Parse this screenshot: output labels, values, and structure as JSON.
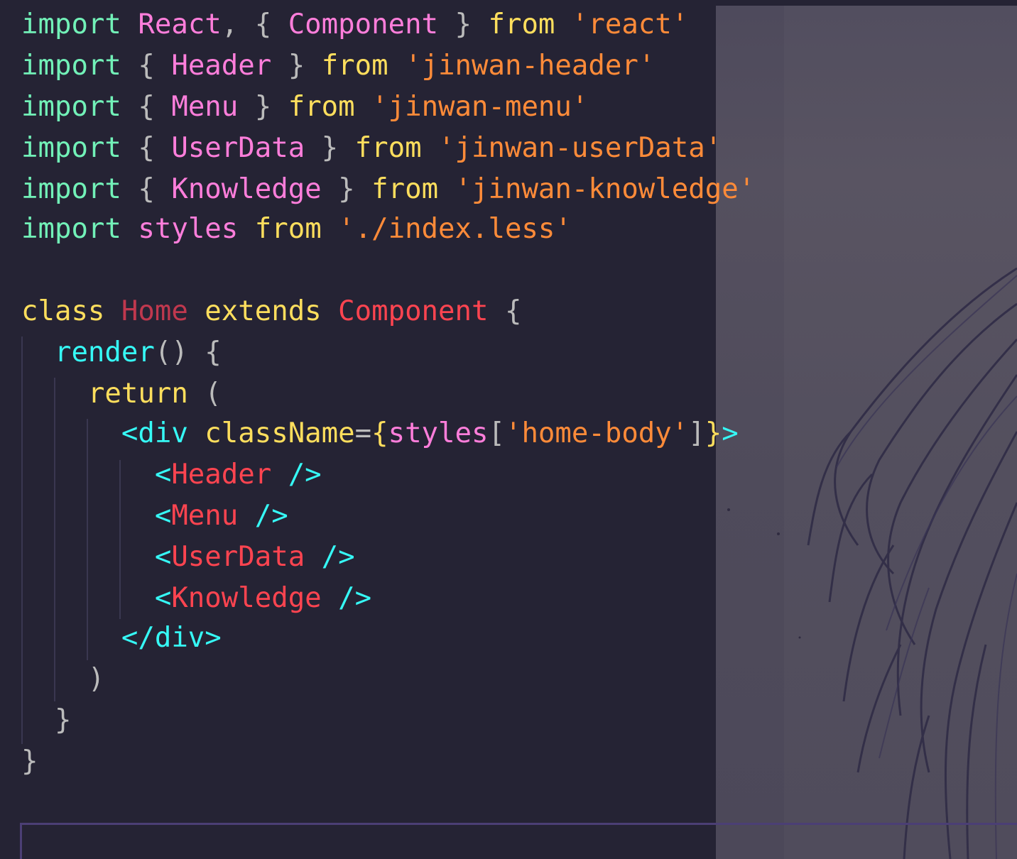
{
  "lines": [
    {
      "t": [
        {
          "c": "kw-green",
          "v": "import"
        },
        {
          "c": "plain",
          "v": " "
        },
        {
          "c": "pink",
          "v": "React"
        },
        {
          "c": "plain",
          "v": ", { "
        },
        {
          "c": "pink",
          "v": "Component"
        },
        {
          "c": "plain",
          "v": " } "
        },
        {
          "c": "kw-yellow",
          "v": "from"
        },
        {
          "c": "plain",
          "v": " "
        },
        {
          "c": "orange",
          "v": "'react'"
        }
      ]
    },
    {
      "t": [
        {
          "c": "kw-green",
          "v": "import"
        },
        {
          "c": "plain",
          "v": " { "
        },
        {
          "c": "pink",
          "v": "Header"
        },
        {
          "c": "plain",
          "v": " } "
        },
        {
          "c": "kw-yellow",
          "v": "from"
        },
        {
          "c": "plain",
          "v": " "
        },
        {
          "c": "orange",
          "v": "'jinwan-header'"
        }
      ]
    },
    {
      "t": [
        {
          "c": "kw-green",
          "v": "import"
        },
        {
          "c": "plain",
          "v": " { "
        },
        {
          "c": "pink",
          "v": "Menu"
        },
        {
          "c": "plain",
          "v": " } "
        },
        {
          "c": "kw-yellow",
          "v": "from"
        },
        {
          "c": "plain",
          "v": " "
        },
        {
          "c": "orange",
          "v": "'jinwan-menu'"
        }
      ]
    },
    {
      "t": [
        {
          "c": "kw-green",
          "v": "import"
        },
        {
          "c": "plain",
          "v": " { "
        },
        {
          "c": "pink",
          "v": "UserData"
        },
        {
          "c": "plain",
          "v": " } "
        },
        {
          "c": "kw-yellow",
          "v": "from"
        },
        {
          "c": "plain",
          "v": " "
        },
        {
          "c": "orange",
          "v": "'jinwan-userData'"
        }
      ]
    },
    {
      "t": [
        {
          "c": "kw-green",
          "v": "import"
        },
        {
          "c": "plain",
          "v": " { "
        },
        {
          "c": "pink",
          "v": "Knowledge"
        },
        {
          "c": "plain",
          "v": " } "
        },
        {
          "c": "kw-yellow",
          "v": "from"
        },
        {
          "c": "plain",
          "v": " "
        },
        {
          "c": "orange",
          "v": "'jinwan-knowledge'"
        }
      ]
    },
    {
      "t": [
        {
          "c": "kw-green",
          "v": "import"
        },
        {
          "c": "plain",
          "v": " "
        },
        {
          "c": "pink",
          "v": "styles"
        },
        {
          "c": "plain",
          "v": " "
        },
        {
          "c": "kw-yellow",
          "v": "from"
        },
        {
          "c": "plain",
          "v": " "
        },
        {
          "c": "orange",
          "v": "'./index.less'"
        }
      ]
    },
    {
      "t": []
    },
    {
      "t": [
        {
          "c": "kw-yellow",
          "v": "class"
        },
        {
          "c": "plain",
          "v": " "
        },
        {
          "c": "crimson",
          "v": "Home"
        },
        {
          "c": "plain",
          "v": " "
        },
        {
          "c": "kw-yellow",
          "v": "extends"
        },
        {
          "c": "plain",
          "v": " "
        },
        {
          "c": "red",
          "v": "Component"
        },
        {
          "c": "plain",
          "v": " {"
        }
      ]
    },
    {
      "t": [
        {
          "c": "plain",
          "v": "  "
        },
        {
          "c": "cyan",
          "v": "render"
        },
        {
          "c": "plain",
          "v": "() {"
        }
      ]
    },
    {
      "t": [
        {
          "c": "plain",
          "v": "    "
        },
        {
          "c": "kw-yellow",
          "v": "return"
        },
        {
          "c": "plain",
          "v": " ("
        }
      ]
    },
    {
      "t": [
        {
          "c": "plain",
          "v": "      "
        },
        {
          "c": "cyan",
          "v": "<div"
        },
        {
          "c": "plain",
          "v": " "
        },
        {
          "c": "kw-yellow",
          "v": "className"
        },
        {
          "c": "plain",
          "v": "="
        },
        {
          "c": "kw-yellow",
          "v": "{"
        },
        {
          "c": "pink",
          "v": "styles"
        },
        {
          "c": "plain",
          "v": "["
        },
        {
          "c": "orange",
          "v": "'home-body'"
        },
        {
          "c": "plain",
          "v": "]"
        },
        {
          "c": "kw-yellow",
          "v": "}"
        },
        {
          "c": "cyan",
          "v": ">"
        }
      ]
    },
    {
      "t": [
        {
          "c": "plain",
          "v": "        "
        },
        {
          "c": "cyan",
          "v": "<"
        },
        {
          "c": "red",
          "v": "Header"
        },
        {
          "c": "plain",
          "v": " "
        },
        {
          "c": "cyan",
          "v": "/>"
        }
      ]
    },
    {
      "t": [
        {
          "c": "plain",
          "v": "        "
        },
        {
          "c": "cyan",
          "v": "<"
        },
        {
          "c": "red",
          "v": "Menu"
        },
        {
          "c": "plain",
          "v": " "
        },
        {
          "c": "cyan",
          "v": "/>"
        }
      ]
    },
    {
      "t": [
        {
          "c": "plain",
          "v": "        "
        },
        {
          "c": "cyan",
          "v": "<"
        },
        {
          "c": "red",
          "v": "UserData"
        },
        {
          "c": "plain",
          "v": " "
        },
        {
          "c": "cyan",
          "v": "/>"
        }
      ]
    },
    {
      "t": [
        {
          "c": "plain",
          "v": "        "
        },
        {
          "c": "cyan",
          "v": "<"
        },
        {
          "c": "red",
          "v": "Knowledge"
        },
        {
          "c": "plain",
          "v": " "
        },
        {
          "c": "cyan",
          "v": "/>"
        }
      ]
    },
    {
      "t": [
        {
          "c": "plain",
          "v": "      "
        },
        {
          "c": "cyan",
          "v": "</div>"
        }
      ]
    },
    {
      "t": [
        {
          "c": "plain",
          "v": "    )"
        }
      ]
    },
    {
      "t": [
        {
          "c": "plain",
          "v": "  }"
        }
      ]
    },
    {
      "t": [
        {
          "c": "plain",
          "v": "}"
        }
      ]
    }
  ],
  "theme_colors": {
    "background": "#252334",
    "keyword_green": "#72f1b8",
    "keyword_yellow": "#fede5d",
    "pink": "#ff7edb",
    "string_orange": "#ff8b39",
    "red": "#fe4450",
    "cyan": "#36f9f6",
    "plain": "#bbbbbb"
  }
}
